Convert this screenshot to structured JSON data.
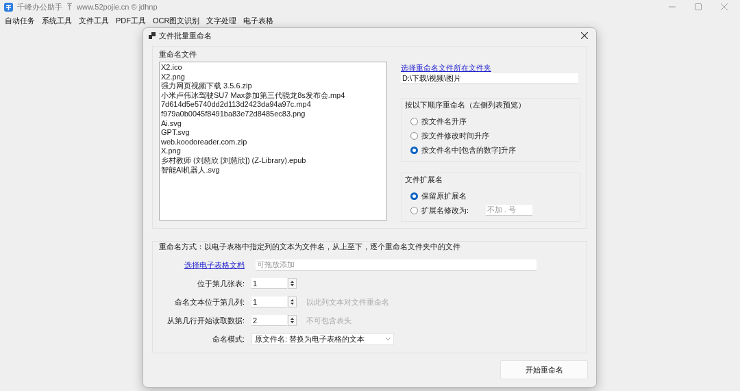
{
  "app": {
    "title": "千峰办公助手",
    "subtitle": "www.52pojie.cn © jdhnp",
    "menu": [
      {
        "label": "自动任务"
      },
      {
        "label": "系统工具"
      },
      {
        "label": "文件工具"
      },
      {
        "label": "PDF工具"
      },
      {
        "label": "OCR图文识别"
      },
      {
        "label": "文字处理"
      },
      {
        "label": "电子表格"
      }
    ]
  },
  "dialog": {
    "title": "文件批量重命名",
    "files_group": {
      "label": "重命名文件",
      "files": [
        "X2.ico",
        "X2.png",
        "强力网页视频下载 3.5.6.zip",
        "小米卢伟冰驾驶SU7 Max参加第三代骁龙8s发布会.mp4",
        "7d614d5e5740dd2d113d2423da94a97c.mp4",
        "f979a0b0045f8491ba83e72d8485ec83.png",
        "Ai.svg",
        "GPT.svg",
        "web.koodoreader.com.zip",
        "X.png",
        "乡村教师 (刘慈欣 [刘慈欣]) (Z-Library).epub",
        "智能AI机器人.svg"
      ],
      "folder_link": "选择重命名文件所在文件夹",
      "folder_path": "D:\\下载\\视频\\图片",
      "order_group": {
        "label": "按以下顺序重命名（左侧列表预览）",
        "options": [
          {
            "label": "按文件名升序",
            "selected": false
          },
          {
            "label": "按文件修改时间升序",
            "selected": false
          },
          {
            "label": "按文件名中[包含的数字]升序",
            "selected": true
          }
        ]
      },
      "ext_group": {
        "label": "文件扩展名",
        "options": [
          {
            "kind": "plain",
            "label": "保留原扩展名",
            "selected": true
          },
          {
            "kind": "input",
            "label": "扩展名修改为:",
            "selected": false,
            "placeholder": "不加 . 号"
          }
        ]
      }
    },
    "sheet_group": {
      "description": "重命名方式：以电子表格中指定列的文本为文件名，从上至下，逐个重命名文件夹中的文件",
      "sheet_link": "选择电子表格文档",
      "sheet_placeholder": "可拖放添加",
      "fields": [
        {
          "label": "位于第几张表:",
          "value": "1"
        },
        {
          "label": "命名文本位于第几列:",
          "value": "1",
          "hint": "以此列文本对文件重命名"
        },
        {
          "label": "从第几行开始读取数据:",
          "value": "2",
          "hint": "不可包含表头"
        }
      ],
      "mode": {
        "label": "命名模式:",
        "value": "原文件名: 替换为电子表格的文本"
      }
    },
    "start_button": "开始重命名"
  }
}
